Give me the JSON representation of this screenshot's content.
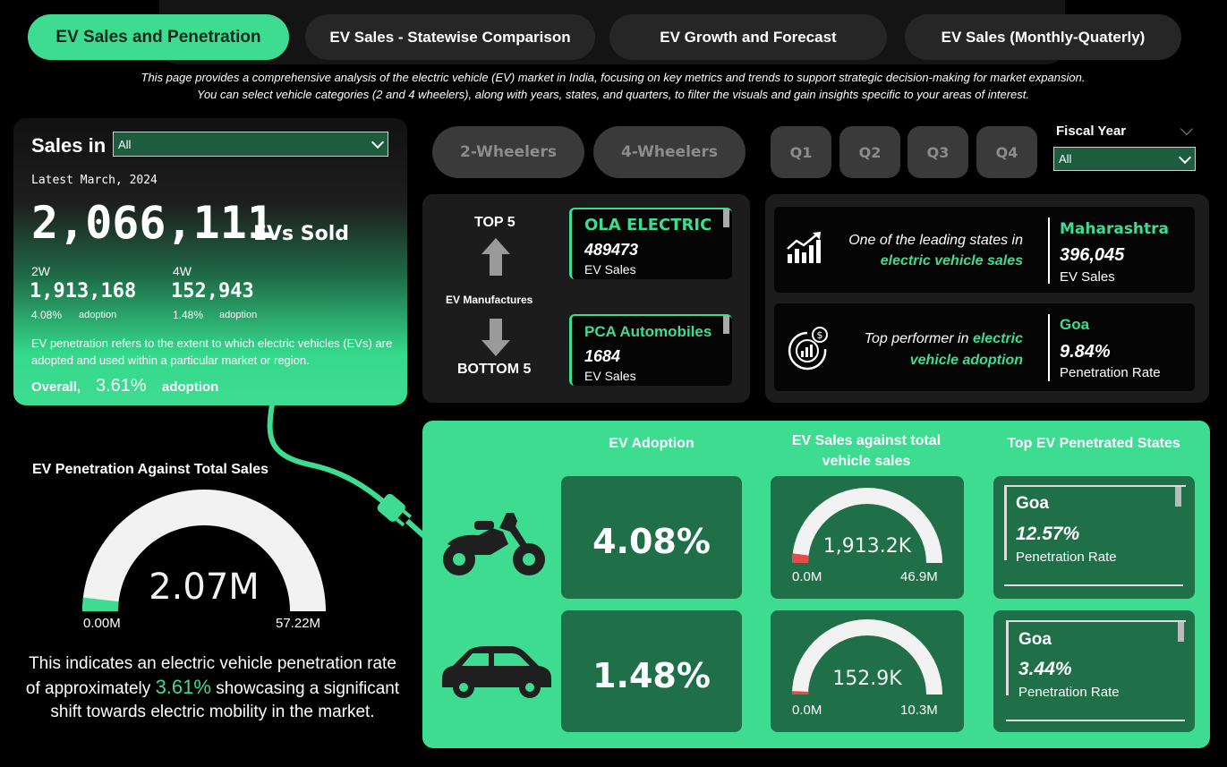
{
  "nav": {
    "tabs": [
      {
        "label": "EV Sales and Penetration",
        "active": true
      },
      {
        "label": "EV Sales - Statewise Comparison",
        "active": false
      },
      {
        "label": "EV Growth and Forecast",
        "active": false
      },
      {
        "label": "EV Sales (Monthly-Quaterly)",
        "active": false
      }
    ]
  },
  "intro": {
    "line1": "This page provides a comprehensive analysis of the electric vehicle (EV) market in India, focusing on key metrics and trends to support strategic decision-making for market expansion.",
    "line2": "You can select vehicle categories (2 and 4 wheelers), along with years, states, and quarters, to filter the visuals and gain insights specific to your areas of interest."
  },
  "summary": {
    "sales_in_label": "Sales in",
    "sales_in_value": "All",
    "latest": "Latest March, 2024",
    "total": "2,066,111",
    "total_suffix": "EVs Sold",
    "tw_label": "2W",
    "tw_value": "1,913,168",
    "tw_pct": "4.08%",
    "tw_adopt": "adoption",
    "fw_label": "4W",
    "fw_value": "152,943",
    "fw_pct": "1.48%",
    "fw_adopt": "adoption",
    "definition": "EV penetration refers to the extent to which electric vehicles (EVs) are adopted and used within a particular market or region.",
    "overall_label": "Overall,",
    "overall_pct": "3.61%",
    "overall_suffix": "adoption"
  },
  "filters": {
    "vehicle": [
      "2-Wheelers",
      "4-Wheelers"
    ],
    "quarters": [
      "Q1",
      "Q2",
      "Q3",
      "Q4"
    ],
    "fiscal_year_label": "Fiscal Year",
    "fiscal_year_value": "All"
  },
  "manufacturers": {
    "top_label": "TOP 5",
    "bottom_label": "BOTTOM 5",
    "caption": "EV Manufactures",
    "top_name": "OLA ELECTRIC",
    "top_value": "489473",
    "top_unit": "EV Sales",
    "bottom_name": "PCA Automobiles",
    "bottom_value": "1684",
    "bottom_unit": "EV Sales"
  },
  "states": {
    "sales_text_a": "One of the leading states in",
    "sales_text_b": "electric vehicle sales",
    "sales_state": "Maharashtra",
    "sales_value": "396,045",
    "sales_unit": "EV Sales",
    "adopt_text_a": "Top performer in",
    "adopt_text_b": "electric",
    "adopt_text_c": "vehicle adoption",
    "adopt_state": "Goa",
    "adopt_value": "9.84%",
    "adopt_unit": "Penetration Rate"
  },
  "penetration_gauge": {
    "title": "EV Penetration Against Total Sales",
    "value_label": "2.07M",
    "min_label": "0.00M",
    "max_label": "57.22M",
    "fraction": 0.0361,
    "text_a": "This indicates an electric vehicle penetration rate of approximately",
    "text_pct": "3.61%",
    "text_b": "showcasing a significant shift towards electric mobility in the market."
  },
  "breakdown": {
    "col_adoption": "EV Adoption",
    "col_sales": "EV Sales against total vehicle sales",
    "col_states": "Top EV Penetrated States",
    "rows": [
      {
        "adoption": "4.08%",
        "gauge_value": "1,913.2K",
        "gauge_min": "0.0M",
        "gauge_max": "46.9M",
        "fraction": 0.0408,
        "state": "Goa",
        "state_rate": "12.57%",
        "state_unit": "Penetration Rate"
      },
      {
        "adoption": "1.48%",
        "gauge_value": "152.9K",
        "gauge_min": "0.0M",
        "gauge_max": "10.3M",
        "fraction": 0.0148,
        "state": "Goa",
        "state_rate": "3.44%",
        "state_unit": "Penetration Rate"
      }
    ]
  },
  "colors": {
    "accent": "#3ddc91",
    "dark_green": "#1f7048",
    "gauge_track": "#f2f2f2",
    "gauge_fill_green": "#3ddc91",
    "gauge_fill_red": "#e24c4c"
  }
}
